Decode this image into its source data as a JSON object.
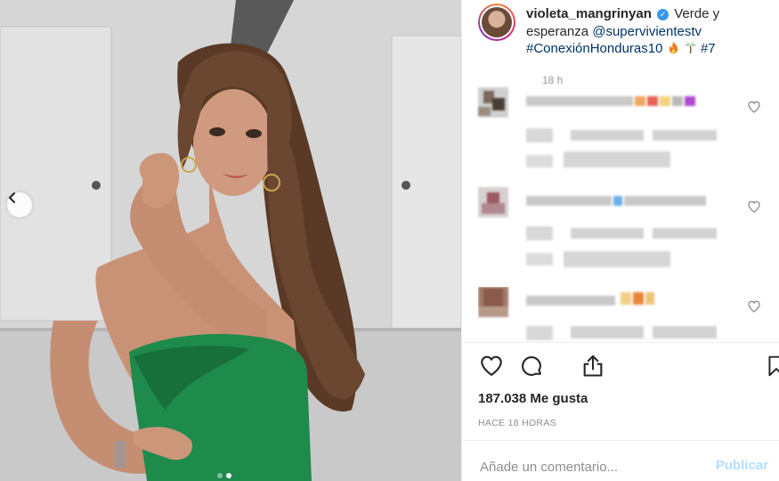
{
  "post": {
    "username": "violeta_mangrinyan",
    "verified_glyph": "✓",
    "caption_text": "Verde y esperanza",
    "mention": "@supervivientestv",
    "hashtag": "#ConexiónHonduras10",
    "hashtag2": "#7",
    "caption_emojis": [
      "fire-icon",
      "palm-tree-icon"
    ],
    "blurred_time": "18 h"
  },
  "photo": {
    "icons": {
      "prev": "chevron-left-icon"
    },
    "dress_color": "#1e8a4c",
    "slides_total": 2,
    "slide_active": 2
  },
  "actions": {
    "icons": [
      "heart-icon",
      "comment-icon",
      "share-icon",
      "bookmark-icon"
    ]
  },
  "likes": "187.038 Me gusta",
  "time_ago": "HACE 18 HORAS",
  "comment_box": {
    "placeholder": "Añade un comentario...",
    "publish_label": "Publicar"
  },
  "colors": {
    "link": "#003569",
    "publish_disabled": "#b2dffc",
    "verified": "#3897f0",
    "muted": "#8e8e8e"
  }
}
